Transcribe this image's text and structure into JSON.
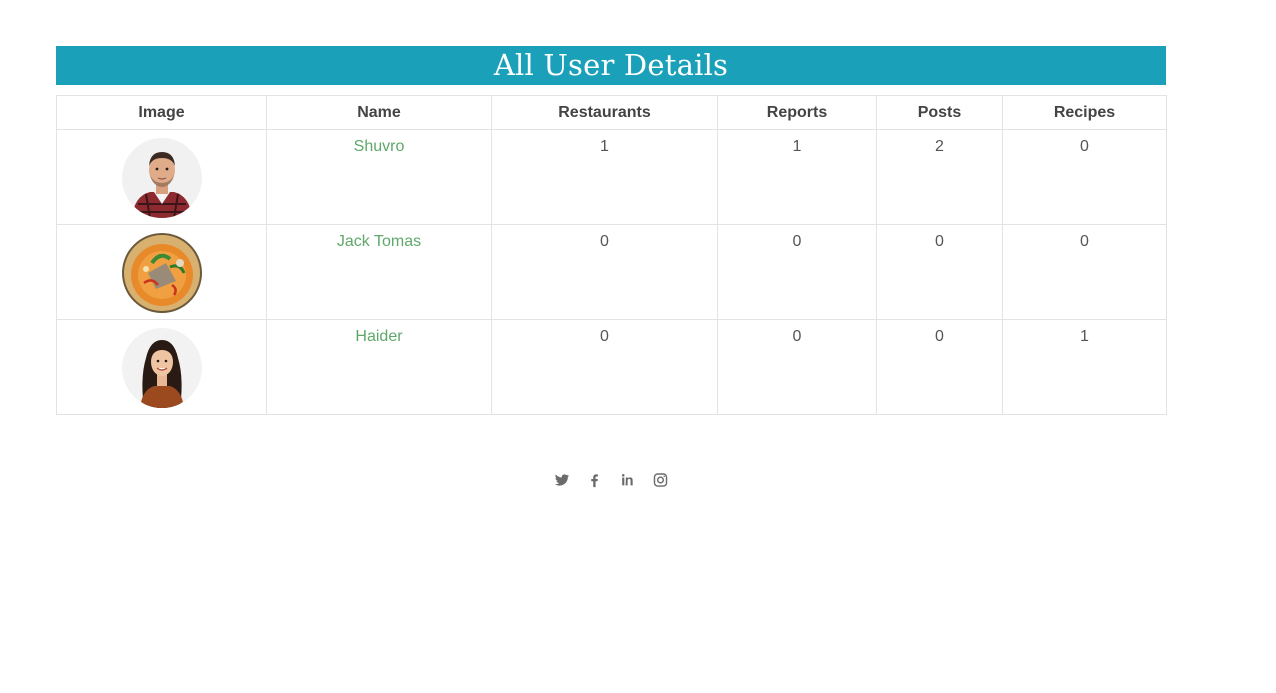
{
  "page": {
    "title": "All User Details"
  },
  "table": {
    "headers": {
      "image": "Image",
      "name": "Name",
      "restaurants": "Restaurants",
      "reports": "Reports",
      "posts": "Posts",
      "recipes": "Recipes"
    },
    "rows": [
      {
        "name": "Shuvro",
        "restaurants": "1",
        "reports": "1",
        "posts": "2",
        "recipes": "0",
        "avatar": "man-portrait"
      },
      {
        "name": "Jack Tomas",
        "restaurants": "0",
        "reports": "0",
        "posts": "0",
        "recipes": "0",
        "avatar": "food-bowl"
      },
      {
        "name": "Haider",
        "restaurants": "0",
        "reports": "0",
        "posts": "0",
        "recipes": "1",
        "avatar": "woman-portrait"
      }
    ]
  },
  "footer": {
    "social": [
      "twitter-icon",
      "facebook-icon",
      "linkedin-icon",
      "instagram-icon"
    ]
  },
  "colors": {
    "title_bar": "#1ba0b9",
    "name_link": "#5fa86a",
    "border": "#e3e3e3"
  }
}
